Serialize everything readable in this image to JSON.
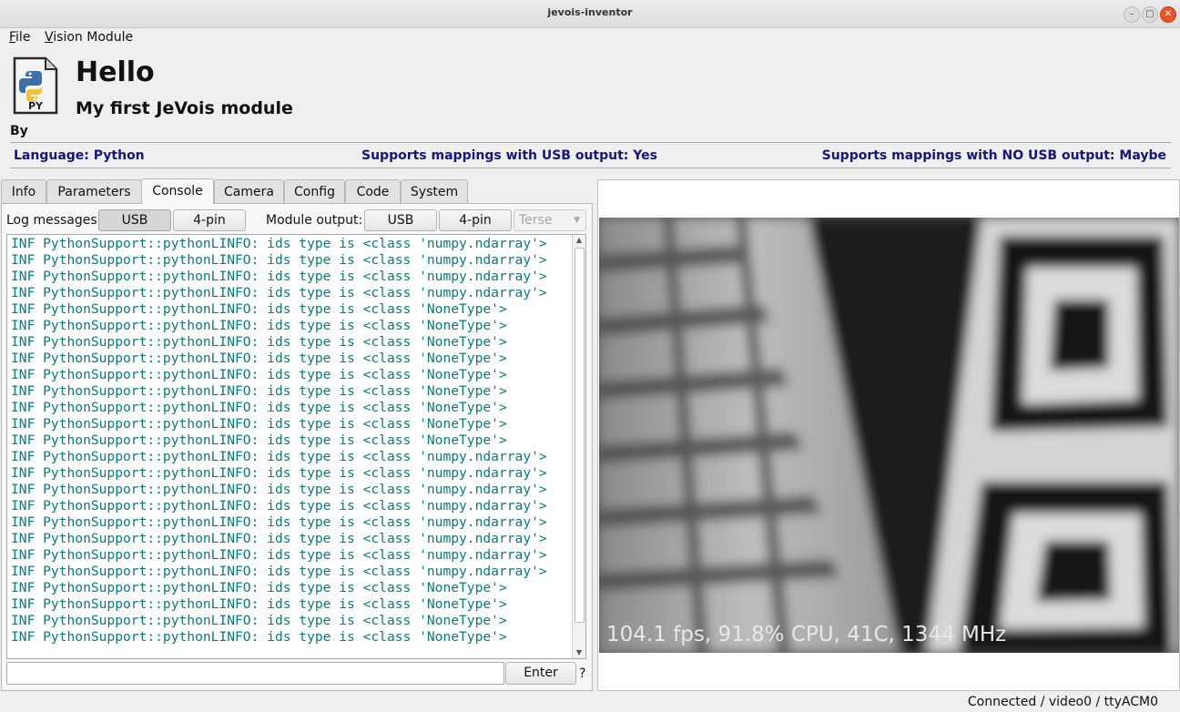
{
  "window": {
    "title": "jevois-inventor"
  },
  "menu": {
    "items": [
      {
        "mnemonic": "F",
        "rest": "ile"
      },
      {
        "mnemonic": "V",
        "rest": "ision Module"
      }
    ]
  },
  "module": {
    "icon_label": "PY",
    "name": "Hello",
    "subtitle": "My first JeVois module",
    "by": "By",
    "language": "Language: Python",
    "usb_support": "Supports mappings with USB output: Yes",
    "nousb_support": "Supports mappings with NO USB output: Maybe"
  },
  "tabs": [
    "Info",
    "Parameters",
    "Console",
    "Camera",
    "Config",
    "Code",
    "System"
  ],
  "active_tab": "Console",
  "console": {
    "log_label": "Log messages:",
    "log_usb": "USB",
    "log_4pin": "4-pin",
    "output_label": "Module output:",
    "out_usb": "USB",
    "out_4pin": "4-pin",
    "verbosity": "Terse",
    "lines": [
      "INF PythonSupport::pythonLINFO: ids type is <class 'numpy.ndarray'>",
      "INF PythonSupport::pythonLINFO: ids type is <class 'numpy.ndarray'>",
      "INF PythonSupport::pythonLINFO: ids type is <class 'numpy.ndarray'>",
      "INF PythonSupport::pythonLINFO: ids type is <class 'numpy.ndarray'>",
      "INF PythonSupport::pythonLINFO: ids type is <class 'NoneType'>",
      "INF PythonSupport::pythonLINFO: ids type is <class 'NoneType'>",
      "INF PythonSupport::pythonLINFO: ids type is <class 'NoneType'>",
      "INF PythonSupport::pythonLINFO: ids type is <class 'NoneType'>",
      "INF PythonSupport::pythonLINFO: ids type is <class 'NoneType'>",
      "INF PythonSupport::pythonLINFO: ids type is <class 'NoneType'>",
      "INF PythonSupport::pythonLINFO: ids type is <class 'NoneType'>",
      "INF PythonSupport::pythonLINFO: ids type is <class 'NoneType'>",
      "INF PythonSupport::pythonLINFO: ids type is <class 'NoneType'>",
      "INF PythonSupport::pythonLINFO: ids type is <class 'numpy.ndarray'>",
      "INF PythonSupport::pythonLINFO: ids type is <class 'numpy.ndarray'>",
      "INF PythonSupport::pythonLINFO: ids type is <class 'numpy.ndarray'>",
      "INF PythonSupport::pythonLINFO: ids type is <class 'numpy.ndarray'>",
      "INF PythonSupport::pythonLINFO: ids type is <class 'numpy.ndarray'>",
      "INF PythonSupport::pythonLINFO: ids type is <class 'numpy.ndarray'>",
      "INF PythonSupport::pythonLINFO: ids type is <class 'numpy.ndarray'>",
      "INF PythonSupport::pythonLINFO: ids type is <class 'numpy.ndarray'>",
      "INF PythonSupport::pythonLINFO: ids type is <class 'NoneType'>",
      "INF PythonSupport::pythonLINFO: ids type is <class 'NoneType'>",
      "INF PythonSupport::pythonLINFO: ids type is <class 'NoneType'>",
      "INF PythonSupport::pythonLINFO: ids type is <class 'NoneType'>"
    ],
    "input_value": "",
    "enter_label": "Enter",
    "help_label": "?"
  },
  "video": {
    "overlay": "104.1 fps, 91.8% CPU, 41C, 1344 MHz"
  },
  "status": {
    "text": "Connected / video0 / ttyACM0"
  },
  "colors": {
    "log_text": "#0b7a7a",
    "info_text": "#16167a"
  }
}
